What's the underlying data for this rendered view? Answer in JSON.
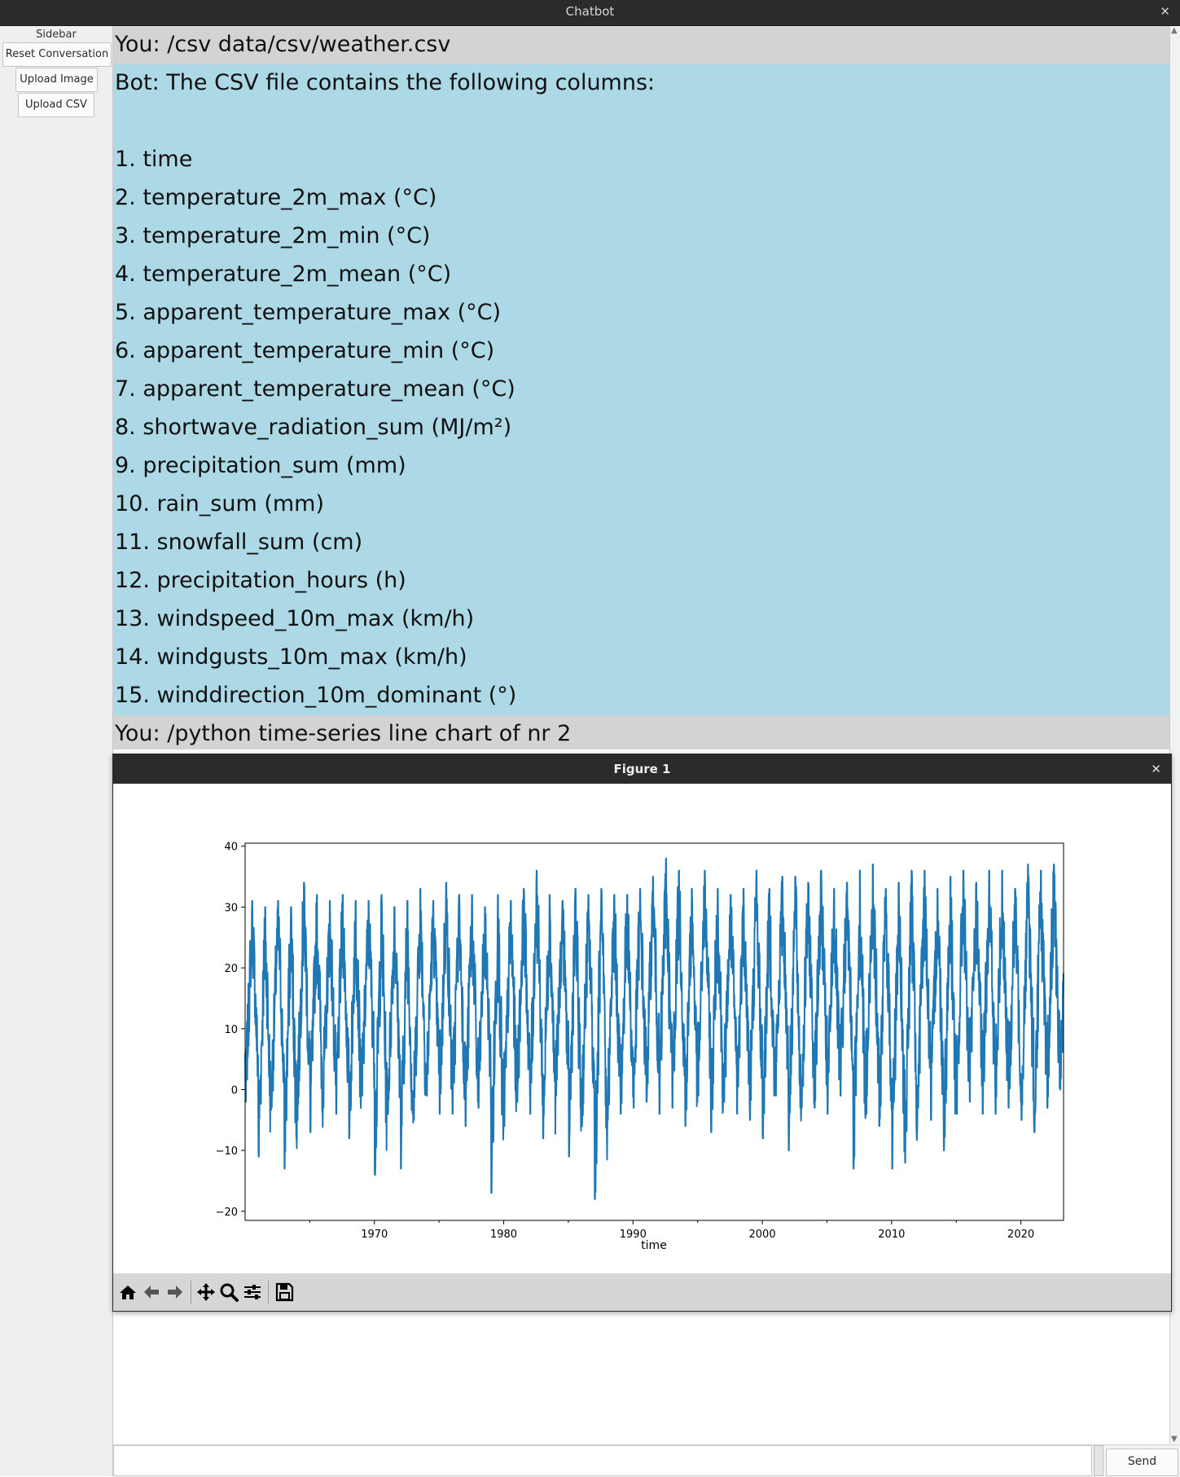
{
  "window": {
    "title": "Chatbot",
    "close_glyph": "✕"
  },
  "sidebar": {
    "label": "Sidebar",
    "reset_label": "Reset Conversation",
    "upload_image_label": "Upload Image",
    "upload_csv_label": "Upload CSV"
  },
  "chat": {
    "msg1": "You: /csv data/csv/weather.csv",
    "bot_lines": [
      "Bot: The CSV file contains the following columns:",
      "",
      "1. time",
      "2. temperature_2m_max (°C)",
      "3. temperature_2m_min (°C)",
      "4. temperature_2m_mean (°C)",
      "5. apparent_temperature_max (°C)",
      "6. apparent_temperature_min (°C)",
      "7. apparent_temperature_mean (°C)",
      "8. shortwave_radiation_sum (MJ/m²)",
      "9. precipitation_sum (mm)",
      "10. rain_sum (mm)",
      "11. snowfall_sum (cm)",
      "12. precipitation_hours (h)",
      "13. windspeed_10m_max (km/h)",
      "14. windgusts_10m_max (km/h)",
      "15. winddirection_10m_dominant (°)"
    ],
    "msg3": "You: /python time-series line chart of nr 2",
    "colors": {
      "user_bg": "#d3d3d3",
      "bot_bg": "#add8e6"
    }
  },
  "figure": {
    "title": "Figure 1",
    "close_glyph": "✕",
    "toolbar": {
      "icons": [
        "home-icon",
        "back-arrow-icon",
        "forward-arrow-icon",
        "pan-icon",
        "zoom-icon",
        "configure-subplots-icon",
        "save-icon"
      ]
    }
  },
  "input": {
    "value": "",
    "send_label": "Send"
  },
  "chart_data": {
    "type": "line",
    "xlabel": "time",
    "ylabel": "",
    "title": "",
    "xlim": [
      1960.0,
      2023.3
    ],
    "ylim": [
      -21.5,
      40.5
    ],
    "x_ticks": [
      1970,
      1980,
      1990,
      2000,
      2010,
      2020
    ],
    "y_ticks": [
      -20,
      -10,
      0,
      10,
      20,
      30,
      40
    ],
    "grid": false,
    "line_color": "#1f77b4",
    "series": [
      {
        "x_start_year": 1960.0,
        "x_end_year": 2023.3,
        "annual_summer_peaks": [
          31,
          30,
          31,
          30,
          34,
          32,
          31,
          32,
          31,
          31,
          32,
          30,
          31,
          33,
          31,
          34,
          32,
          32,
          30,
          32,
          31,
          33,
          36,
          32,
          31,
          33,
          32,
          33,
          32,
          32,
          33,
          35,
          38,
          36,
          33,
          36,
          33,
          32,
          33,
          36,
          33,
          35,
          35,
          34,
          36,
          33,
          34,
          36,
          37,
          33,
          34,
          36,
          36,
          33,
          35,
          36,
          34,
          36,
          36,
          33,
          37,
          36,
          37,
          36
        ],
        "annual_winter_troughs": [
          -2,
          -11,
          -3,
          -13,
          -5,
          -7,
          -3,
          -4,
          -8,
          -1,
          -14,
          -4,
          -13,
          -5,
          -1,
          -4,
          -4,
          -6,
          -3,
          -17,
          -6,
          -2,
          -4,
          -8,
          -1,
          -11,
          -6,
          -18,
          -5,
          -4,
          -3,
          -2,
          -4,
          -3,
          -6,
          -1,
          -7,
          -2,
          -4,
          -5,
          -8,
          -1,
          -10,
          -3,
          -3,
          -4,
          -1,
          -13,
          -4,
          -6,
          -13,
          -12,
          -3,
          -5,
          -10,
          -4,
          -2,
          -4,
          -4,
          -3,
          -5,
          -7,
          -3,
          0
        ]
      }
    ]
  }
}
